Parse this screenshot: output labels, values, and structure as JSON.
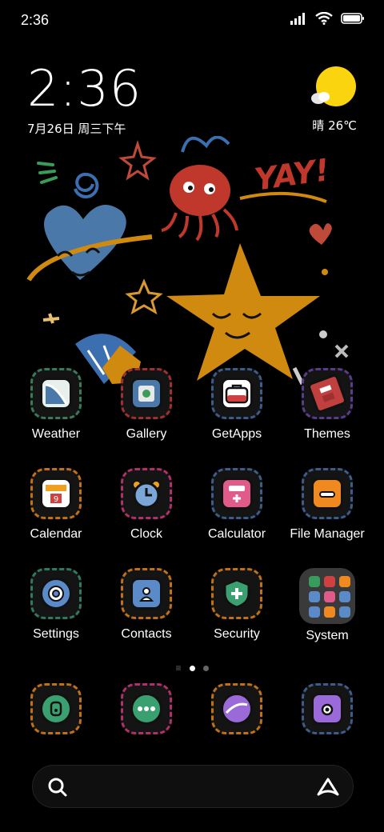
{
  "status_bar": {
    "time": "2:36"
  },
  "clock_widget": {
    "time": "2:36",
    "date": "7月26日 周三下午"
  },
  "weather_widget": {
    "text": "晴 26℃",
    "sun_color": "#f9d40f"
  },
  "apps": [
    {
      "label": "Weather",
      "icon": "weather-icon",
      "color": "#4a8a5a"
    },
    {
      "label": "Gallery",
      "icon": "gallery-icon",
      "color": "#b03030"
    },
    {
      "label": "GetApps",
      "icon": "getapps-icon",
      "color": "#3c5c8c"
    },
    {
      "label": "Themes",
      "icon": "themes-icon",
      "color": "#6a3c8c"
    },
    {
      "label": "Calendar",
      "icon": "calendar-icon",
      "color": "#c07018"
    },
    {
      "label": "Clock",
      "icon": "clock-icon",
      "color": "#b0306a"
    },
    {
      "label": "Calculator",
      "icon": "calculator-icon",
      "color": "#3c5c8c"
    },
    {
      "label": "File Manager",
      "icon": "file-manager-icon",
      "color": "#3c5c8c"
    },
    {
      "label": "Settings",
      "icon": "settings-icon",
      "color": "#2f7a5a"
    },
    {
      "label": "Contacts",
      "icon": "contacts-icon",
      "color": "#c07018"
    },
    {
      "label": "Security",
      "icon": "security-icon",
      "color": "#c07018"
    },
    {
      "label": "System",
      "icon": "system-folder-icon",
      "color": "#3a3a3a"
    }
  ],
  "dock": [
    {
      "icon": "phone-icon",
      "color": "#c07018"
    },
    {
      "icon": "messages-icon",
      "color": "#b0306a"
    },
    {
      "icon": "browser-icon",
      "color": "#c07018"
    },
    {
      "icon": "camera-icon",
      "color": "#3c5c8c"
    }
  ],
  "page_indicator": {
    "current": 1,
    "total": 2
  },
  "search_bar": {
    "left_icon": "search-icon",
    "right_icon": "app-vault-icon"
  }
}
